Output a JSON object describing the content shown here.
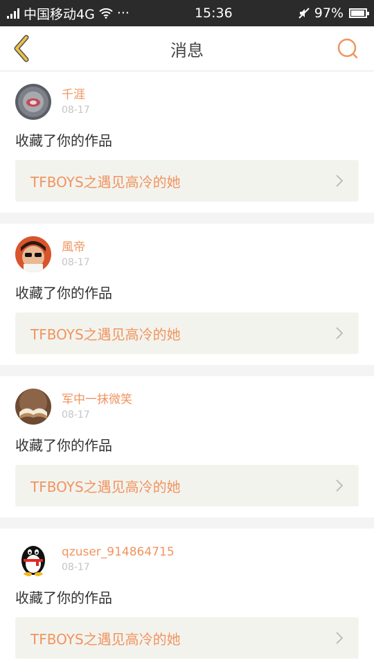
{
  "status_bar": {
    "carrier": "中国移动4G",
    "dots": "···",
    "time": "15:36",
    "battery": "97%"
  },
  "header": {
    "title": "消息",
    "back_icon": "chevron-left-icon",
    "search_icon": "search-icon"
  },
  "colors": {
    "accent": "#f0945f",
    "back": "#e8c04a"
  },
  "messages": [
    {
      "user": "千涯",
      "date": "08-17",
      "action": "收藏了你的作品",
      "work": "TFBOYS之遇见高冷的她"
    },
    {
      "user": "風帝",
      "date": "08-17",
      "action": "收藏了你的作品",
      "work": "TFBOYS之遇见高冷的她"
    },
    {
      "user": "军中一抹微笑",
      "date": "08-17",
      "action": "收藏了你的作品",
      "work": "TFBOYS之遇见高冷的她"
    },
    {
      "user": "qzuser_914864715",
      "date": "08-17",
      "action": "收藏了你的作品",
      "work": "TFBOYS之遇见高冷的她"
    }
  ]
}
